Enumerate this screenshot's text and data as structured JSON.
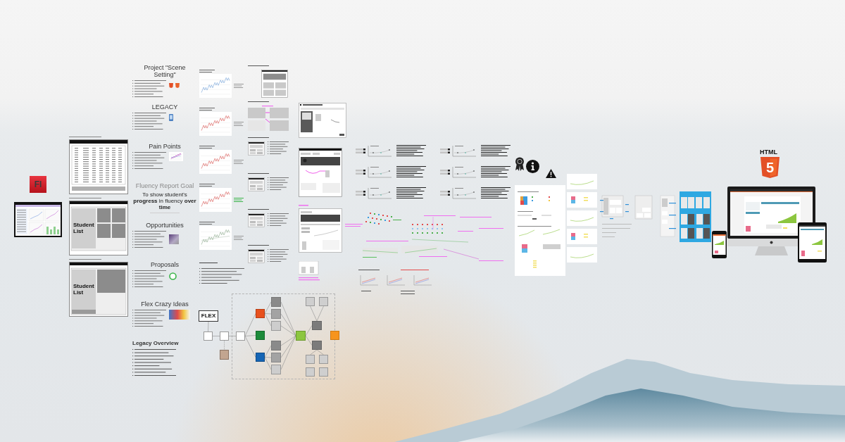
{
  "logos": {
    "flash": "Fl",
    "html": "HTML",
    "html_number": "5"
  },
  "legacy_boards": [
    {
      "kind": "table"
    },
    {
      "kind": "tiles",
      "panel": "Student List"
    },
    {
      "kind": "detail",
      "panel": "Student List"
    }
  ],
  "slides": [
    {
      "kind": "bullets",
      "heading": "Project \"Scene Setting\""
    },
    {
      "kind": "bullets",
      "heading": "LEGACY"
    },
    {
      "kind": "bullets",
      "heading": "Pain Points"
    },
    {
      "kind": "goal",
      "heading": "Fluency Report Goal",
      "statement": "To show student's **progress** in fluency **over time**"
    },
    {
      "kind": "bullets",
      "heading": "Opportunities"
    },
    {
      "kind": "bullets",
      "heading": "Proposals"
    },
    {
      "kind": "bullets",
      "heading": "Flex Crazy Ideas"
    },
    {
      "kind": "overview",
      "heading": "Legacy Overview"
    }
  ],
  "sections": [
    {
      "kind": "mockup"
    },
    {
      "kind": "relation"
    },
    {
      "kind": "bullets"
    },
    {
      "kind": "bullets"
    },
    {
      "kind": "bullets"
    },
    {
      "kind": "bullets"
    }
  ],
  "flow": {
    "root": "FLEX"
  }
}
